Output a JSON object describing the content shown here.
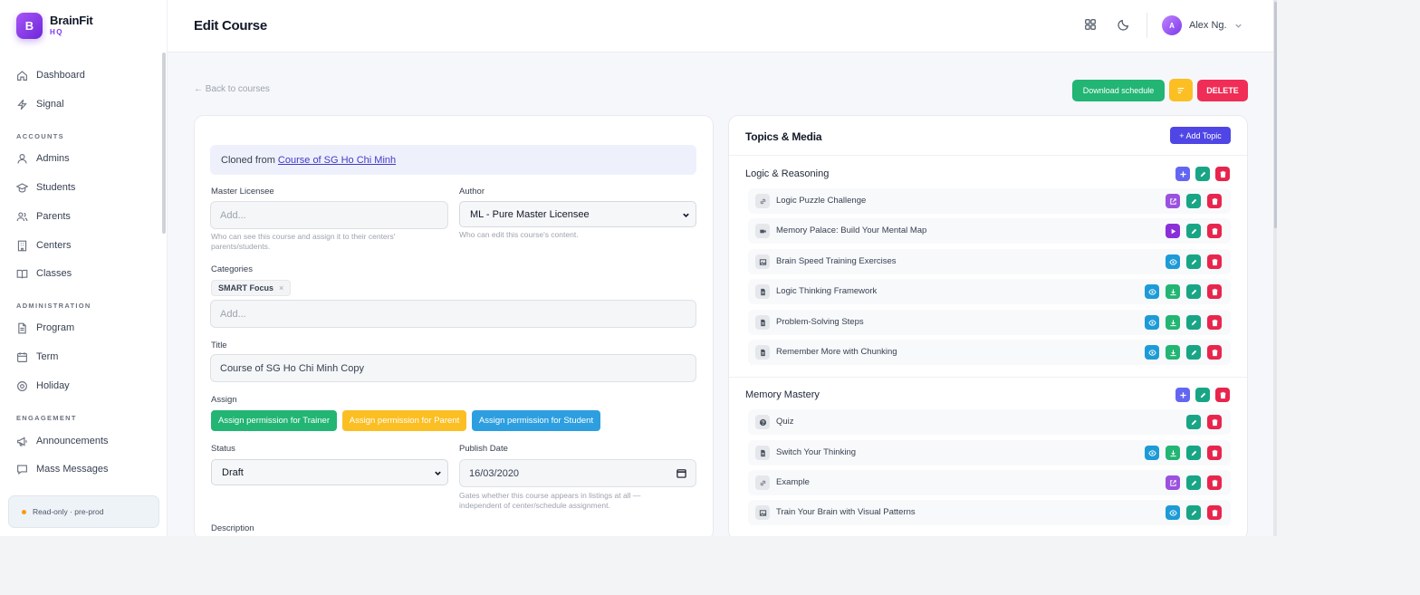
{
  "brand": {
    "logo_letter": "B",
    "name": "BrainFit",
    "sub": "HQ"
  },
  "nav": {
    "dashboard": "Dashboard",
    "signal": "Signal",
    "section_accounts": "ACCOUNTS",
    "admins": "Admins",
    "students": "Students",
    "parents": "Parents",
    "centers": "Centers",
    "classes": "Classes",
    "section_administration": "ADMINISTRATION",
    "program": "Program",
    "term": "Term",
    "holiday": "Holiday",
    "section_engagement": "ENGAGEMENT",
    "announcements": "Announcements",
    "mass_messages": "Mass Messages"
  },
  "env_badge": "Read-only · pre-prod",
  "header": {
    "title": "Edit Course",
    "user_initial": "A",
    "user_name": "Alex Ng."
  },
  "actions": {
    "back": "← Back to courses",
    "download": "Download schedule",
    "delete": "DELETE"
  },
  "form": {
    "cloned_prefix": "Cloned from",
    "cloned_link": "Course of SG Ho Chi Minh",
    "master_licensee_label": "Master Licensee",
    "master_licensee_placeholder": "Add...",
    "master_licensee_help": "Who can see this course and assign it to their centers' parents/students.",
    "author_label": "Author",
    "author_value": "ML - Pure Master Licensee",
    "author_help": "Who can edit this course's content.",
    "categories_label": "Categories",
    "category_chip": "SMART Focus",
    "category_chip_remove": "×",
    "categories_placeholder": "Add...",
    "title_label": "Title",
    "title_value": "Course of SG Ho Chi Minh Copy",
    "assign_label": "Assign",
    "assign_trainer": "Assign permission for Trainer",
    "assign_parent": "Assign permission for Parent",
    "assign_student": "Assign permission for Student",
    "status_label": "Status",
    "status_value": "Draft",
    "publish_label": "Publish Date",
    "publish_value": "16/03/2020",
    "publish_help": "Gates whether this course appears in listings at all — independent of center/schedule assignment.",
    "description_label": "Description"
  },
  "topics": {
    "title": "Topics & Media",
    "add_topic": "+ Add Topic",
    "groups": [
      {
        "name": "Logic & Reasoning",
        "items": [
          {
            "title": "Logic Puzzle Challenge",
            "icon": "link-icon"
          },
          {
            "title": "Memory Palace: Build Your Mental Map",
            "icon": "video-icon"
          },
          {
            "title": "Brain Speed Training Exercises",
            "icon": "image-icon"
          },
          {
            "title": "Logic Thinking Framework",
            "icon": "document-icon"
          },
          {
            "title": "Problem-Solving Steps",
            "icon": "document-icon"
          },
          {
            "title": "Remember More with Chunking",
            "icon": "document-icon"
          }
        ]
      },
      {
        "name": "Memory Mastery",
        "items": [
          {
            "title": "Quiz",
            "icon": "quiz-icon"
          },
          {
            "title": "Switch Your Thinking",
            "icon": "document-icon"
          },
          {
            "title": "Example",
            "icon": "link-icon"
          },
          {
            "title": "Train Your Brain with Visual Patterns",
            "icon": "image-icon"
          }
        ]
      }
    ]
  },
  "colors": {
    "brand": "#7c3aed",
    "download": "#22b573",
    "sort": "#fbbf24",
    "delete": "#ef2d56",
    "trainer": "#22b573",
    "parent": "#fbbf24",
    "student": "#2d9fe0",
    "add_topic": "#4f46e5"
  }
}
